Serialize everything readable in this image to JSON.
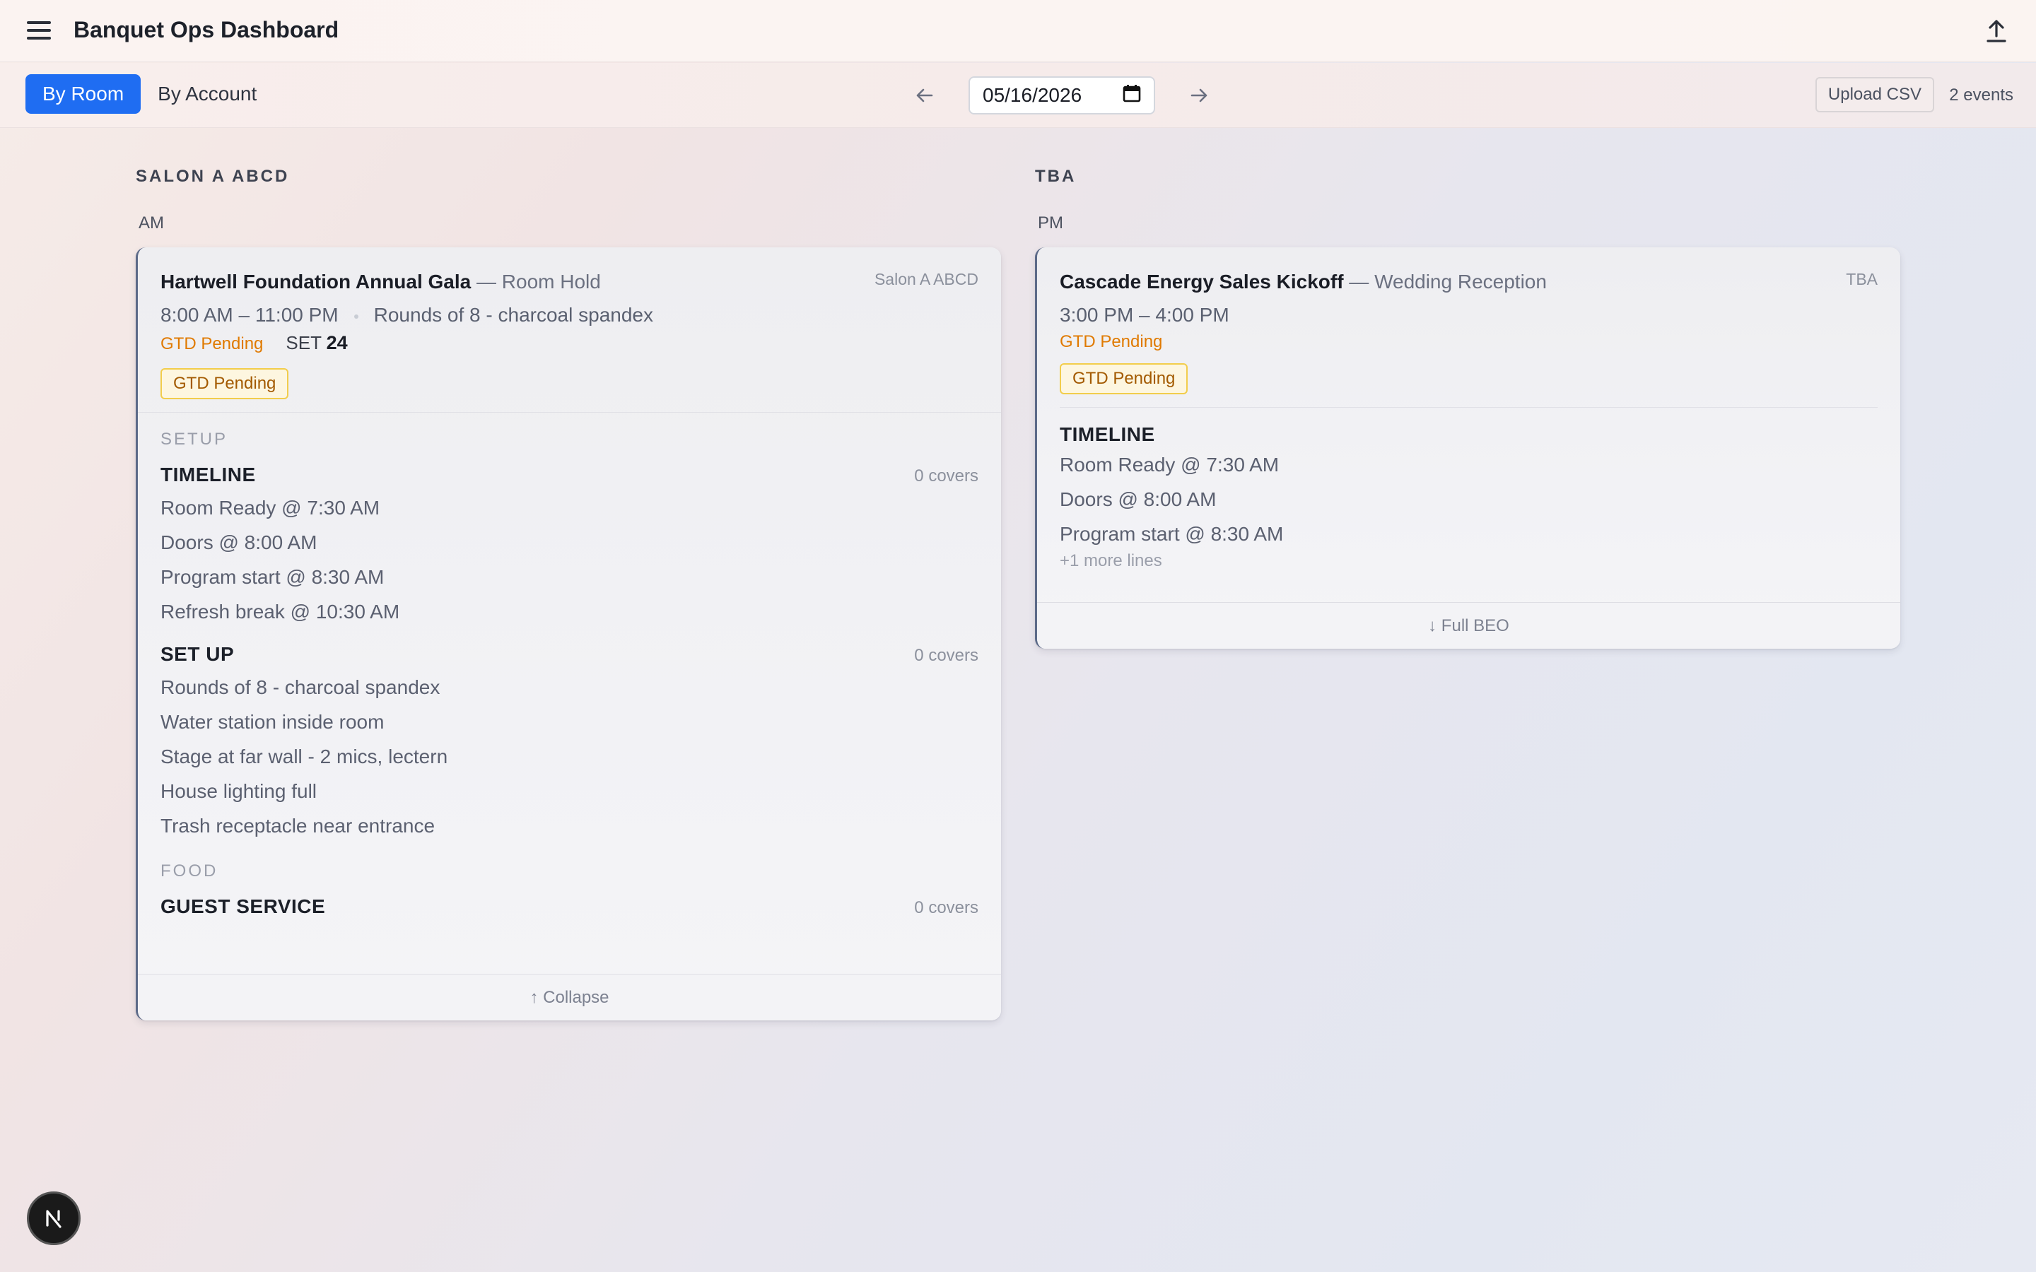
{
  "header": {
    "title": "Banquet Ops Dashboard",
    "menu_icon": "hamburger-menu-icon",
    "upload_icon": "upload-icon"
  },
  "toolbar": {
    "view_tabs": [
      {
        "label": "By Room",
        "active": true
      },
      {
        "label": "By Account",
        "active": false
      }
    ],
    "date_value": "05/16/2026",
    "prev_icon": "arrow-left-icon",
    "next_icon": "arrow-right-icon",
    "upload_csv_label": "Upload CSV",
    "event_count": "2 events"
  },
  "rooms": [
    {
      "heading": "SALON A ABCD",
      "slot": "AM",
      "event": {
        "name": "Hartwell Foundation Annual Gala",
        "type": "— Room Hold",
        "room": "Salon A ABCD",
        "time": "8:00 AM – 11:00 PM",
        "setup_summary": "Rounds of 8 - charcoal spandex",
        "status": "GTD Pending",
        "set_label": "SET",
        "set_value": "24",
        "badge": "GTD Pending",
        "sections": [
          {
            "label": "SETUP",
            "subsections": [
              {
                "title": "TIMELINE",
                "covers": "0 covers",
                "lines": [
                  "Room Ready @ 7:30 AM",
                  "Doors @ 8:00 AM",
                  "Program start @ 8:30 AM",
                  "Refresh break @ 10:30 AM"
                ]
              },
              {
                "title": "SET UP",
                "covers": "0 covers",
                "lines": [
                  "Rounds of 8 - charcoal spandex",
                  "Water station inside room",
                  "Stage at far wall - 2 mics, lectern",
                  "House lighting full",
                  "Trash receptacle near entrance"
                ]
              }
            ]
          },
          {
            "label": "FOOD",
            "subsections": [
              {
                "title": "GUEST SERVICE",
                "covers": "0 covers",
                "lines": []
              }
            ]
          }
        ],
        "footer": "↑ Collapse"
      }
    },
    {
      "heading": "TBA",
      "slot": "PM",
      "event": {
        "name": "Cascade Energy Sales Kickoff",
        "type": "— Wedding Reception",
        "room": "TBA",
        "time": "3:00 PM – 4:00 PM",
        "status": "GTD Pending",
        "badge": "GTD Pending",
        "timeline_title": "TIMELINE",
        "lines": [
          "Room Ready @ 7:30 AM",
          "Doors @ 8:00 AM",
          "Program start @ 8:30 AM"
        ],
        "more_lines": "+1 more lines",
        "footer": "↓ Full BEO"
      }
    }
  ],
  "dev_badge": {
    "letter": "N",
    "icon": "nextjs-logo-icon"
  },
  "colors": {
    "accent": "#1f6df2",
    "status_orange": "#e07a00",
    "badge_border": "#f2cd4c"
  }
}
